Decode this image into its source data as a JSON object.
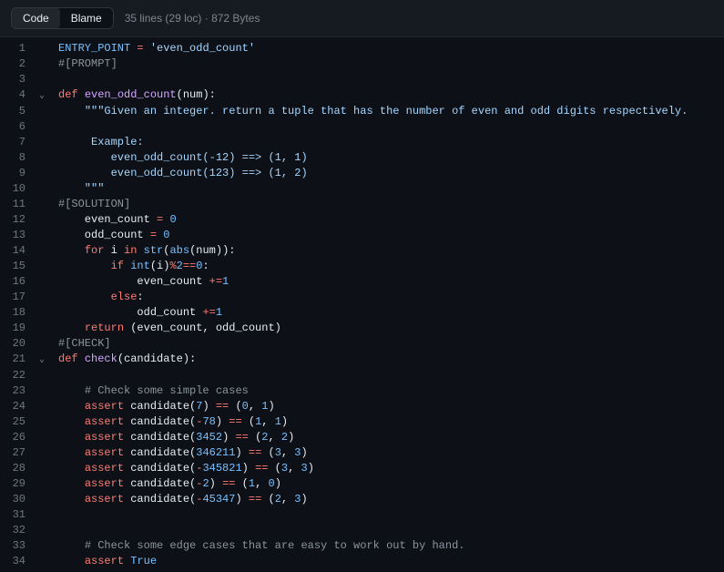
{
  "header": {
    "tab_code": "Code",
    "tab_blame": "Blame",
    "meta": "35 lines (29 loc) · 872 Bytes"
  },
  "chevron": "⌄",
  "code_lines": [
    {
      "n": 1,
      "expand": "",
      "tokens": [
        [
          "c-const",
          "ENTRY_POINT"
        ],
        [
          "c-var",
          " "
        ],
        [
          "c-op",
          "="
        ],
        [
          "c-var",
          " "
        ],
        [
          "c-str",
          "'even_odd_count'"
        ]
      ]
    },
    {
      "n": 2,
      "expand": "",
      "tokens": [
        [
          "c-cm",
          "#[PROMPT]"
        ]
      ]
    },
    {
      "n": 3,
      "expand": "",
      "tokens": []
    },
    {
      "n": 4,
      "expand": "chev",
      "tokens": [
        [
          "c-kw",
          "def"
        ],
        [
          "c-var",
          " "
        ],
        [
          "c-fn",
          "even_odd_count"
        ],
        [
          "c-var",
          "(num):"
        ]
      ]
    },
    {
      "n": 5,
      "expand": "",
      "tokens": [
        [
          "c-var",
          "    "
        ],
        [
          "c-str",
          "\"\"\"Given an integer. return a tuple that has the number of even and odd digits respectively."
        ]
      ]
    },
    {
      "n": 6,
      "expand": "",
      "tokens": []
    },
    {
      "n": 7,
      "expand": "",
      "tokens": [
        [
          "c-str",
          "     Example:"
        ]
      ]
    },
    {
      "n": 8,
      "expand": "",
      "tokens": [
        [
          "c-str",
          "        even_odd_count(-12) ==> (1, 1)"
        ]
      ]
    },
    {
      "n": 9,
      "expand": "",
      "tokens": [
        [
          "c-str",
          "        even_odd_count(123) ==> (1, 2)"
        ]
      ]
    },
    {
      "n": 10,
      "expand": "",
      "tokens": [
        [
          "c-str",
          "    \"\"\""
        ]
      ]
    },
    {
      "n": 11,
      "expand": "",
      "tokens": [
        [
          "c-cm",
          "#[SOLUTION]"
        ]
      ]
    },
    {
      "n": 12,
      "expand": "",
      "tokens": [
        [
          "c-var",
          "    even_count "
        ],
        [
          "c-op",
          "="
        ],
        [
          "c-var",
          " "
        ],
        [
          "c-num",
          "0"
        ]
      ]
    },
    {
      "n": 13,
      "expand": "",
      "tokens": [
        [
          "c-var",
          "    odd_count "
        ],
        [
          "c-op",
          "="
        ],
        [
          "c-var",
          " "
        ],
        [
          "c-num",
          "0"
        ]
      ]
    },
    {
      "n": 14,
      "expand": "",
      "tokens": [
        [
          "c-var",
          "    "
        ],
        [
          "c-kw",
          "for"
        ],
        [
          "c-var",
          " i "
        ],
        [
          "c-kw",
          "in"
        ],
        [
          "c-var",
          " "
        ],
        [
          "c-builtin",
          "str"
        ],
        [
          "c-var",
          "("
        ],
        [
          "c-builtin",
          "abs"
        ],
        [
          "c-var",
          "(num)):"
        ]
      ]
    },
    {
      "n": 15,
      "expand": "",
      "tokens": [
        [
          "c-var",
          "        "
        ],
        [
          "c-kw",
          "if"
        ],
        [
          "c-var",
          " "
        ],
        [
          "c-builtin",
          "int"
        ],
        [
          "c-var",
          "(i)"
        ],
        [
          "c-op",
          "%"
        ],
        [
          "c-num",
          "2"
        ],
        [
          "c-op",
          "=="
        ],
        [
          "c-num",
          "0"
        ],
        [
          "c-var",
          ":"
        ]
      ]
    },
    {
      "n": 16,
      "expand": "",
      "tokens": [
        [
          "c-var",
          "            even_count "
        ],
        [
          "c-op",
          "+="
        ],
        [
          "c-num",
          "1"
        ]
      ]
    },
    {
      "n": 17,
      "expand": "",
      "tokens": [
        [
          "c-var",
          "        "
        ],
        [
          "c-kw",
          "else"
        ],
        [
          "c-var",
          ":"
        ]
      ]
    },
    {
      "n": 18,
      "expand": "",
      "tokens": [
        [
          "c-var",
          "            odd_count "
        ],
        [
          "c-op",
          "+="
        ],
        [
          "c-num",
          "1"
        ]
      ]
    },
    {
      "n": 19,
      "expand": "",
      "tokens": [
        [
          "c-var",
          "    "
        ],
        [
          "c-kw",
          "return"
        ],
        [
          "c-var",
          " (even_count, odd_count)"
        ]
      ]
    },
    {
      "n": 20,
      "expand": "",
      "tokens": [
        [
          "c-cm",
          "#[CHECK]"
        ]
      ]
    },
    {
      "n": 21,
      "expand": "chev",
      "tokens": [
        [
          "c-kw",
          "def"
        ],
        [
          "c-var",
          " "
        ],
        [
          "c-fn",
          "check"
        ],
        [
          "c-var",
          "(candidate):"
        ]
      ]
    },
    {
      "n": 22,
      "expand": "",
      "tokens": []
    },
    {
      "n": 23,
      "expand": "",
      "tokens": [
        [
          "c-var",
          "    "
        ],
        [
          "c-cm",
          "# Check some simple cases"
        ]
      ]
    },
    {
      "n": 24,
      "expand": "",
      "tokens": [
        [
          "c-var",
          "    "
        ],
        [
          "c-kw",
          "assert"
        ],
        [
          "c-var",
          " candidate("
        ],
        [
          "c-num",
          "7"
        ],
        [
          "c-var",
          ") "
        ],
        [
          "c-op",
          "=="
        ],
        [
          "c-var",
          " ("
        ],
        [
          "c-num",
          "0"
        ],
        [
          "c-var",
          ", "
        ],
        [
          "c-num",
          "1"
        ],
        [
          "c-var",
          ")"
        ]
      ]
    },
    {
      "n": 25,
      "expand": "",
      "tokens": [
        [
          "c-var",
          "    "
        ],
        [
          "c-kw",
          "assert"
        ],
        [
          "c-var",
          " candidate("
        ],
        [
          "c-op",
          "-"
        ],
        [
          "c-num",
          "78"
        ],
        [
          "c-var",
          ") "
        ],
        [
          "c-op",
          "=="
        ],
        [
          "c-var",
          " ("
        ],
        [
          "c-num",
          "1"
        ],
        [
          "c-var",
          ", "
        ],
        [
          "c-num",
          "1"
        ],
        [
          "c-var",
          ")"
        ]
      ]
    },
    {
      "n": 26,
      "expand": "",
      "tokens": [
        [
          "c-var",
          "    "
        ],
        [
          "c-kw",
          "assert"
        ],
        [
          "c-var",
          " candidate("
        ],
        [
          "c-num",
          "3452"
        ],
        [
          "c-var",
          ") "
        ],
        [
          "c-op",
          "=="
        ],
        [
          "c-var",
          " ("
        ],
        [
          "c-num",
          "2"
        ],
        [
          "c-var",
          ", "
        ],
        [
          "c-num",
          "2"
        ],
        [
          "c-var",
          ")"
        ]
      ]
    },
    {
      "n": 27,
      "expand": "",
      "tokens": [
        [
          "c-var",
          "    "
        ],
        [
          "c-kw",
          "assert"
        ],
        [
          "c-var",
          " candidate("
        ],
        [
          "c-num",
          "346211"
        ],
        [
          "c-var",
          ") "
        ],
        [
          "c-op",
          "=="
        ],
        [
          "c-var",
          " ("
        ],
        [
          "c-num",
          "3"
        ],
        [
          "c-var",
          ", "
        ],
        [
          "c-num",
          "3"
        ],
        [
          "c-var",
          ")"
        ]
      ]
    },
    {
      "n": 28,
      "expand": "",
      "tokens": [
        [
          "c-var",
          "    "
        ],
        [
          "c-kw",
          "assert"
        ],
        [
          "c-var",
          " candidate("
        ],
        [
          "c-op",
          "-"
        ],
        [
          "c-num",
          "345821"
        ],
        [
          "c-var",
          ") "
        ],
        [
          "c-op",
          "=="
        ],
        [
          "c-var",
          " ("
        ],
        [
          "c-num",
          "3"
        ],
        [
          "c-var",
          ", "
        ],
        [
          "c-num",
          "3"
        ],
        [
          "c-var",
          ")"
        ]
      ]
    },
    {
      "n": 29,
      "expand": "",
      "tokens": [
        [
          "c-var",
          "    "
        ],
        [
          "c-kw",
          "assert"
        ],
        [
          "c-var",
          " candidate("
        ],
        [
          "c-op",
          "-"
        ],
        [
          "c-num",
          "2"
        ],
        [
          "c-var",
          ") "
        ],
        [
          "c-op",
          "=="
        ],
        [
          "c-var",
          " ("
        ],
        [
          "c-num",
          "1"
        ],
        [
          "c-var",
          ", "
        ],
        [
          "c-num",
          "0"
        ],
        [
          "c-var",
          ")"
        ]
      ]
    },
    {
      "n": 30,
      "expand": "",
      "tokens": [
        [
          "c-var",
          "    "
        ],
        [
          "c-kw",
          "assert"
        ],
        [
          "c-var",
          " candidate("
        ],
        [
          "c-op",
          "-"
        ],
        [
          "c-num",
          "45347"
        ],
        [
          "c-var",
          ") "
        ],
        [
          "c-op",
          "=="
        ],
        [
          "c-var",
          " ("
        ],
        [
          "c-num",
          "2"
        ],
        [
          "c-var",
          ", "
        ],
        [
          "c-num",
          "3"
        ],
        [
          "c-var",
          ")"
        ]
      ]
    },
    {
      "n": 31,
      "expand": "",
      "tokens": []
    },
    {
      "n": 32,
      "expand": "",
      "tokens": []
    },
    {
      "n": 33,
      "expand": "",
      "tokens": [
        [
          "c-var",
          "    "
        ],
        [
          "c-cm",
          "# Check some edge cases that are easy to work out by hand."
        ]
      ]
    },
    {
      "n": 34,
      "expand": "",
      "tokens": [
        [
          "c-var",
          "    "
        ],
        [
          "c-kw",
          "assert"
        ],
        [
          "c-var",
          " "
        ],
        [
          "c-num",
          "True"
        ]
      ]
    }
  ]
}
